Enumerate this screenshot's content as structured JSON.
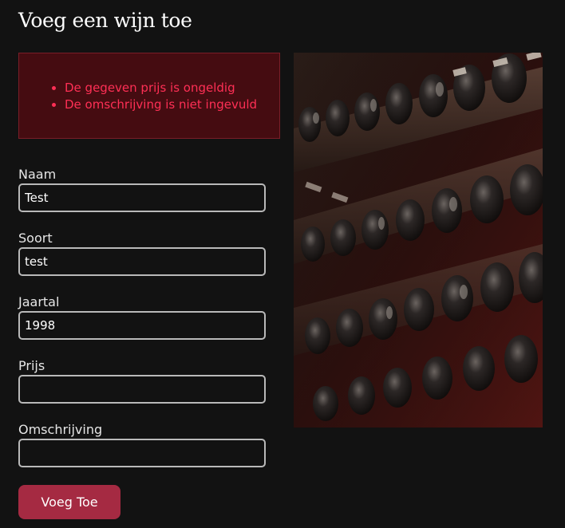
{
  "page": {
    "title": "Voeg een wijn toe"
  },
  "errors": [
    "De gegeven prijs is ongeldig",
    "De omschrijving is niet ingevuld"
  ],
  "form": {
    "naam": {
      "label": "Naam",
      "value": "Test"
    },
    "soort": {
      "label": "Soort",
      "value": "test"
    },
    "jaartal": {
      "label": "Jaartal",
      "value": "1998"
    },
    "prijs": {
      "label": "Prijs",
      "value": ""
    },
    "omschrijving": {
      "label": "Omschrijving",
      "value": ""
    },
    "submit_label": "Voeg Toe"
  },
  "colors": {
    "background": "#121212",
    "error_bg": "#450c11",
    "error_text": "#ff2f55",
    "button": "#a52a42"
  },
  "image": {
    "subject": "wine-bottles-on-rack"
  }
}
